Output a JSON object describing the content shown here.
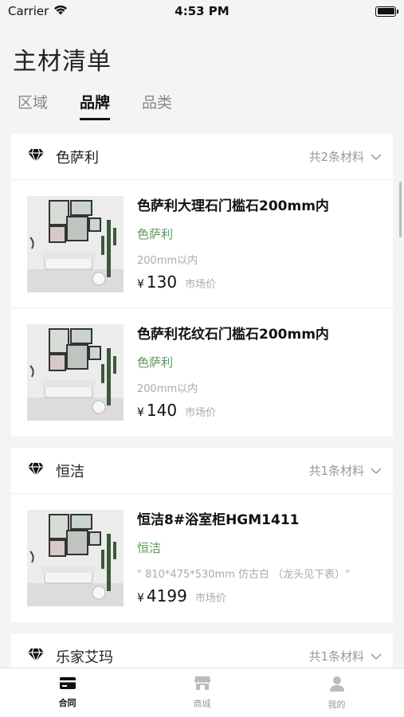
{
  "status_bar": {
    "carrier": "Carrier",
    "time": "4:53 PM"
  },
  "page": {
    "title": "主材清单"
  },
  "tabs": [
    {
      "label": "区域",
      "active": false
    },
    {
      "label": "品牌",
      "active": true
    },
    {
      "label": "品类",
      "active": false
    }
  ],
  "groups": [
    {
      "name": "色萨利",
      "count": "共2条材料",
      "products": [
        {
          "name": "色萨利大理石门槛石200mm内",
          "brand": "色萨利",
          "spec": "200mm以内",
          "yen": "¥",
          "price": "130",
          "price_note": "市场价"
        },
        {
          "name": "色萨利花纹石门槛石200mm内",
          "brand": "色萨利",
          "spec": "200mm以内",
          "yen": "¥",
          "price": "140",
          "price_note": "市场价"
        }
      ]
    },
    {
      "name": "恒洁",
      "count": "共1条材料",
      "products": [
        {
          "name": "恒洁8#浴室柜HGM1411",
          "brand": "恒洁",
          "spec": "\" 810*475*530mm 仿古白 （龙头见下表）\"",
          "yen": "¥",
          "price": "4199",
          "price_note": "市场价"
        }
      ]
    },
    {
      "name": "乐家艾玛",
      "count": "共1条材料",
      "products": []
    }
  ],
  "tabbar": [
    {
      "label": "合同",
      "icon": "card-icon",
      "active": true
    },
    {
      "label": "商城",
      "icon": "store-icon",
      "active": false
    },
    {
      "label": "我的",
      "icon": "person-icon",
      "active": false
    }
  ],
  "colors": {
    "brand_text": "#5a9a5a",
    "muted": "#999999"
  }
}
